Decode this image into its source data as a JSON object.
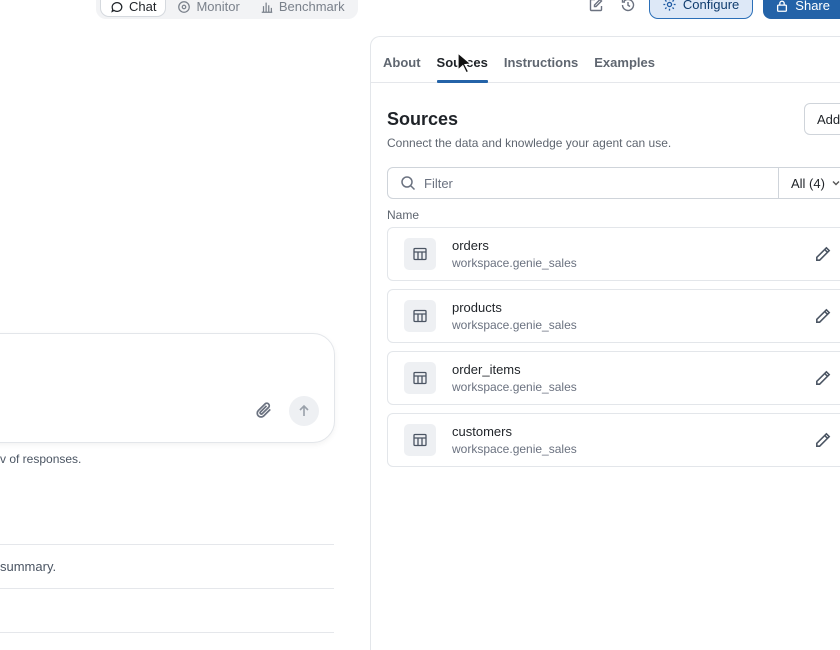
{
  "modes": [
    {
      "label": "Chat",
      "icon": "chat-icon",
      "active": true
    },
    {
      "label": "Monitor",
      "icon": "eye-icon",
      "active": false
    },
    {
      "label": "Benchmark",
      "icon": "bar-chart-icon",
      "active": false
    }
  ],
  "top_actions": {
    "configure_label": "Configure",
    "share_label": "Share"
  },
  "chat": {
    "disclaimer": "v of responses.",
    "suggestions": [
      "summary.",
      "",
      ""
    ]
  },
  "panel": {
    "tabs": [
      "About",
      "Sources",
      "Instructions",
      "Examples"
    ],
    "active_tab": "Sources",
    "title": "Sources",
    "subtitle": "Connect the data and knowledge your agent can use.",
    "add_label": "Add",
    "filter_placeholder": "Filter",
    "filter_select": "All (4)",
    "column_header": "Name",
    "sources": [
      {
        "name": "orders",
        "schema": "workspace.genie_sales"
      },
      {
        "name": "products",
        "schema": "workspace.genie_sales"
      },
      {
        "name": "order_items",
        "schema": "workspace.genie_sales"
      },
      {
        "name": "customers",
        "schema": "workspace.genie_sales"
      }
    ]
  },
  "colors": {
    "accent": "#2463a8",
    "configure_bg": "#dde8f7"
  }
}
